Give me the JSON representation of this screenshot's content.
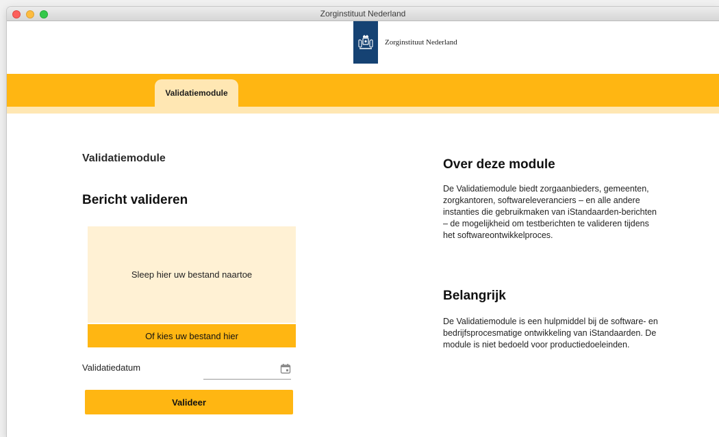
{
  "window": {
    "title": "Zorginstituut Nederland"
  },
  "header": {
    "logo_text": "Zorginstituut Nederland"
  },
  "nav": {
    "tabs": [
      {
        "label": "Validatiemodule",
        "active": true
      }
    ]
  },
  "main": {
    "page_heading": "Validatiemodule",
    "section_title": "Bericht valideren",
    "dropzone_text": "Sleep hier uw bestand naartoe",
    "choose_file_label": "Of kies uw bestand hier",
    "date_label": "Validatiedatum",
    "date_value": "",
    "validate_label": "Valideer"
  },
  "aside": {
    "about_title": "Over deze module",
    "about_text": "De Validatiemodule biedt zorgaanbieders, gemeenten, zorgkantoren, softwareleveranciers – en alle andere instanties die gebruikmaken van iStandaarden-berichten – de mogelijkheid om testberichten te valideren tijdens het softwareontwikkelproces.",
    "important_title": "Belangrijk",
    "important_text": "De Validatiemodule is een hulpmiddel bij de software- en bedrijfsprocesmatige ontwikkeling van iStandaarden. De module is niet bedoeld voor productiedoeleinden."
  },
  "icons": [
    "close-icon",
    "minimize-icon",
    "zoom-icon",
    "coat-of-arms-icon",
    "calendar-icon"
  ],
  "colors": {
    "accent": "#ffb612",
    "accent_light": "#ffe7b3",
    "dropzone_bg": "#fff1d4",
    "logo_blue": "#154273"
  }
}
